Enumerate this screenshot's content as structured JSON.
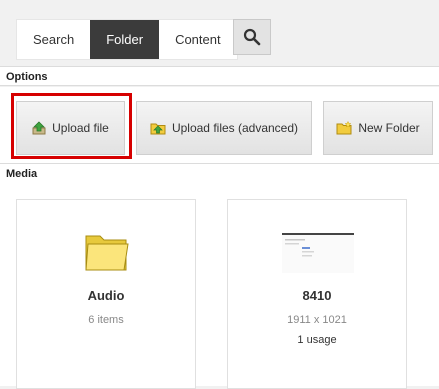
{
  "tabs": [
    {
      "label": "Search"
    },
    {
      "label": "Folder"
    },
    {
      "label": "Content"
    }
  ],
  "active_tab": "Folder",
  "search_icon": "magnifier-icon",
  "options": {
    "label": "Options",
    "buttons": [
      {
        "label": "Upload file",
        "icon": "upload-icon"
      },
      {
        "label": "Upload files (advanced)",
        "icon": "upload-folder-icon"
      },
      {
        "label": "New Folder",
        "icon": "new-folder-icon"
      }
    ]
  },
  "media": {
    "label": "Media",
    "items": [
      {
        "title": "Audio",
        "subtitle": "6 items",
        "icon": "folder-icon"
      },
      {
        "title": "8410",
        "dimensions": "1911 x 1021",
        "usage": "1 usage",
        "icon": "screenshot-thumbnail"
      }
    ]
  },
  "colors": {
    "highlight": "#d60000",
    "active_tab": "#3b3b3b"
  }
}
